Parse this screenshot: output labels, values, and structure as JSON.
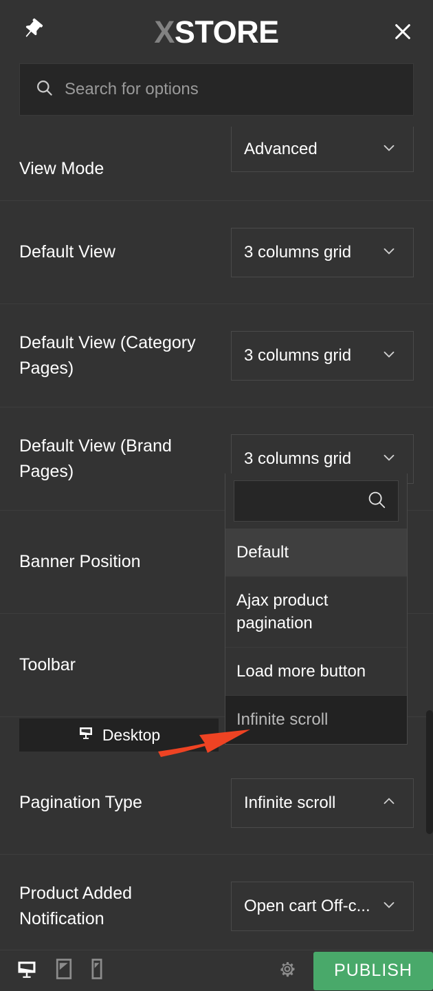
{
  "header": {
    "logo_x": "X",
    "logo_text": "STORE",
    "pin_icon": "pin-icon",
    "close_icon": "close-icon"
  },
  "search": {
    "placeholder": "Search for options",
    "icon": "search-icon"
  },
  "options": [
    {
      "label": "View Mode",
      "value": "Advanced"
    },
    {
      "label": "Default View",
      "value": "3 columns grid"
    },
    {
      "label": "Default View (Category Pages)",
      "value": "3 columns grid"
    },
    {
      "label": "Default View (Brand Pages)",
      "value": "3 columns grid"
    },
    {
      "label": "Banner Position",
      "value": ""
    },
    {
      "label": "Toolbar",
      "value": ""
    },
    {
      "label": "Pagination Type",
      "value": "Infinite scroll"
    },
    {
      "label": "Product Added Notification",
      "value": "Open cart Off-c..."
    }
  ],
  "device_tab": {
    "label": "Desktop",
    "icon": "desktop-icon"
  },
  "dropdown": {
    "search_value": "",
    "search_icon": "search-icon",
    "options": [
      {
        "label": "Default",
        "state": "hovered"
      },
      {
        "label": "Ajax product pagination",
        "state": "normal"
      },
      {
        "label": "Load more button",
        "state": "normal"
      },
      {
        "label": "Infinite scroll",
        "state": "selected"
      }
    ]
  },
  "annotation": {
    "type": "red-arrow",
    "color": "#ee4323",
    "points_to": "Infinite scroll"
  },
  "footer": {
    "devices": [
      {
        "name": "desktop-device-icon",
        "active": true
      },
      {
        "name": "tablet-device-icon",
        "active": false
      },
      {
        "name": "mobile-device-icon",
        "active": false
      }
    ],
    "gear_icon": "gear-icon",
    "publish_label": "PUBLISH",
    "publish_color": "#49a96a"
  },
  "colors": {
    "panel_bg": "#333333",
    "input_bg": "#262626",
    "border": "#4a4a4a",
    "divider": "#3d3d3d",
    "selected_bg": "#222222",
    "hover_bg": "#3f3f3f",
    "accent_green": "#49a96a",
    "accent_red": "#ee4323"
  }
}
